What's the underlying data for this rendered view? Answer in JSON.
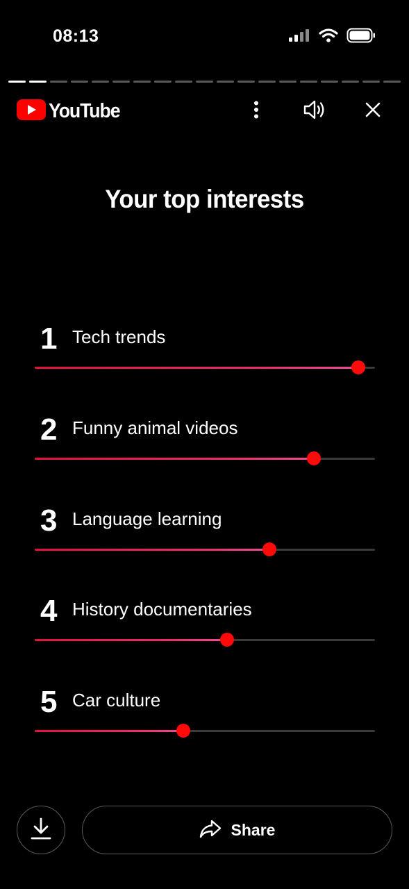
{
  "status_bar": {
    "time": "08:13"
  },
  "story": {
    "segments_total": 19,
    "segments_done": 2
  },
  "header": {
    "brand": "YouTube",
    "brand_color": "#FF0000",
    "icons": [
      "more-vertical-icon",
      "volume-icon",
      "close-icon"
    ]
  },
  "title": "Your top interests",
  "interests": [
    {
      "rank": "1",
      "label": "Tech trends",
      "level": 0.95
    },
    {
      "rank": "2",
      "label": "Funny animal videos",
      "level": 0.82
    },
    {
      "rank": "3",
      "label": "Language learning",
      "level": 0.69
    },
    {
      "rank": "4",
      "label": "History documentaries",
      "level": 0.565
    },
    {
      "rank": "5",
      "label": "Car culture",
      "level": 0.437
    }
  ],
  "actions": {
    "download_icon": "download-icon",
    "share_icon": "share-icon",
    "share_label": "Share"
  },
  "colors": {
    "background": "#000000",
    "accent": "#FF0A0A",
    "fill_start": "#E0123A",
    "fill_end": "#F04C95",
    "track": "#3A3A3A"
  }
}
